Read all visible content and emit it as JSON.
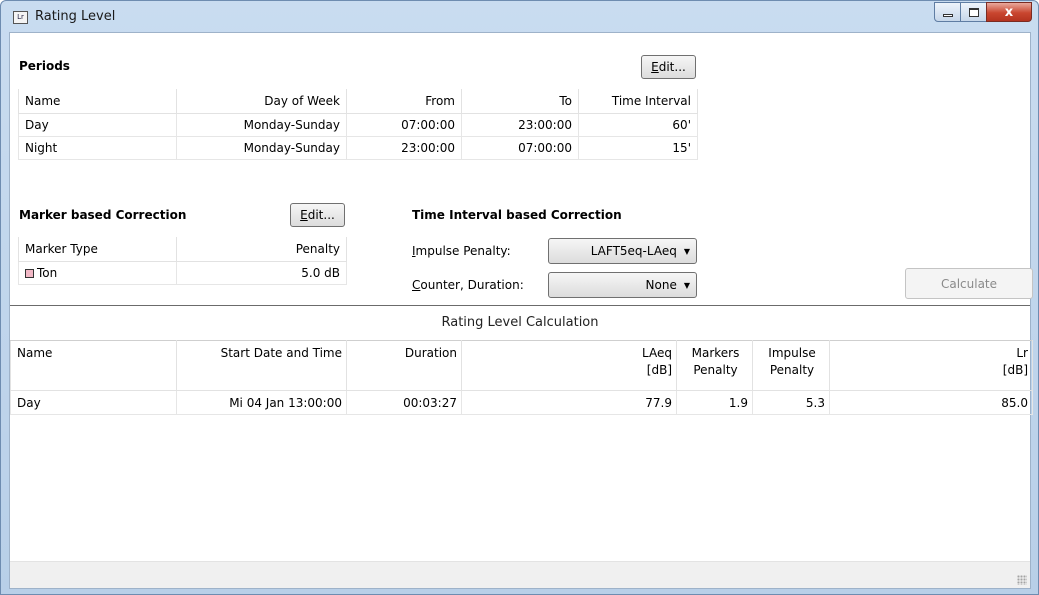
{
  "window": {
    "title": "Rating Level",
    "app_icon_text": "Lr",
    "close_glyph": "x"
  },
  "periods": {
    "heading": "Periods",
    "edit_label": "Edit...",
    "columns": [
      "Name",
      "Day of Week",
      "From",
      "To",
      "Time Interval"
    ],
    "rows": [
      [
        "Day",
        "Monday-Sunday",
        "07:00:00",
        "23:00:00",
        "60'"
      ],
      [
        "Night",
        "Monday-Sunday",
        "23:00:00",
        "07:00:00",
        "15'"
      ]
    ]
  },
  "marker_correction": {
    "heading": "Marker based Correction",
    "edit_label": "Edit...",
    "columns": [
      "Marker Type",
      "Penalty"
    ],
    "rows": [
      {
        "marker": "Ton",
        "penalty": "5.0 dB",
        "swatch_color": "#f2b8c6"
      }
    ]
  },
  "time_interval_correction": {
    "heading": "Time Interval based Correction",
    "impulse_label": "Impulse Penalty:",
    "impulse_value": "LAFT5eq-LAeq",
    "counter_label": "Counter, Duration:",
    "counter_value": "None"
  },
  "calculate_label": "Calculate",
  "results": {
    "heading": "Rating Level Calculation",
    "columns": [
      [
        "Name"
      ],
      [
        "Start Date and Time"
      ],
      [
        "Duration"
      ],
      [
        "LAeq",
        "[dB]"
      ],
      [
        "Markers",
        "Penalty"
      ],
      [
        "Impulse",
        "Penalty"
      ],
      [
        "Lr",
        "[dB]"
      ]
    ],
    "rows": [
      [
        "Day",
        "Mi 04 Jan 13:00:00",
        "00:03:27",
        "77.9",
        "1.9",
        "5.3",
        "85.0"
      ]
    ]
  },
  "colors": {
    "title_bar": "#c9dcf0",
    "close_button": "#c9462f",
    "divider": "#6b6b6b"
  }
}
